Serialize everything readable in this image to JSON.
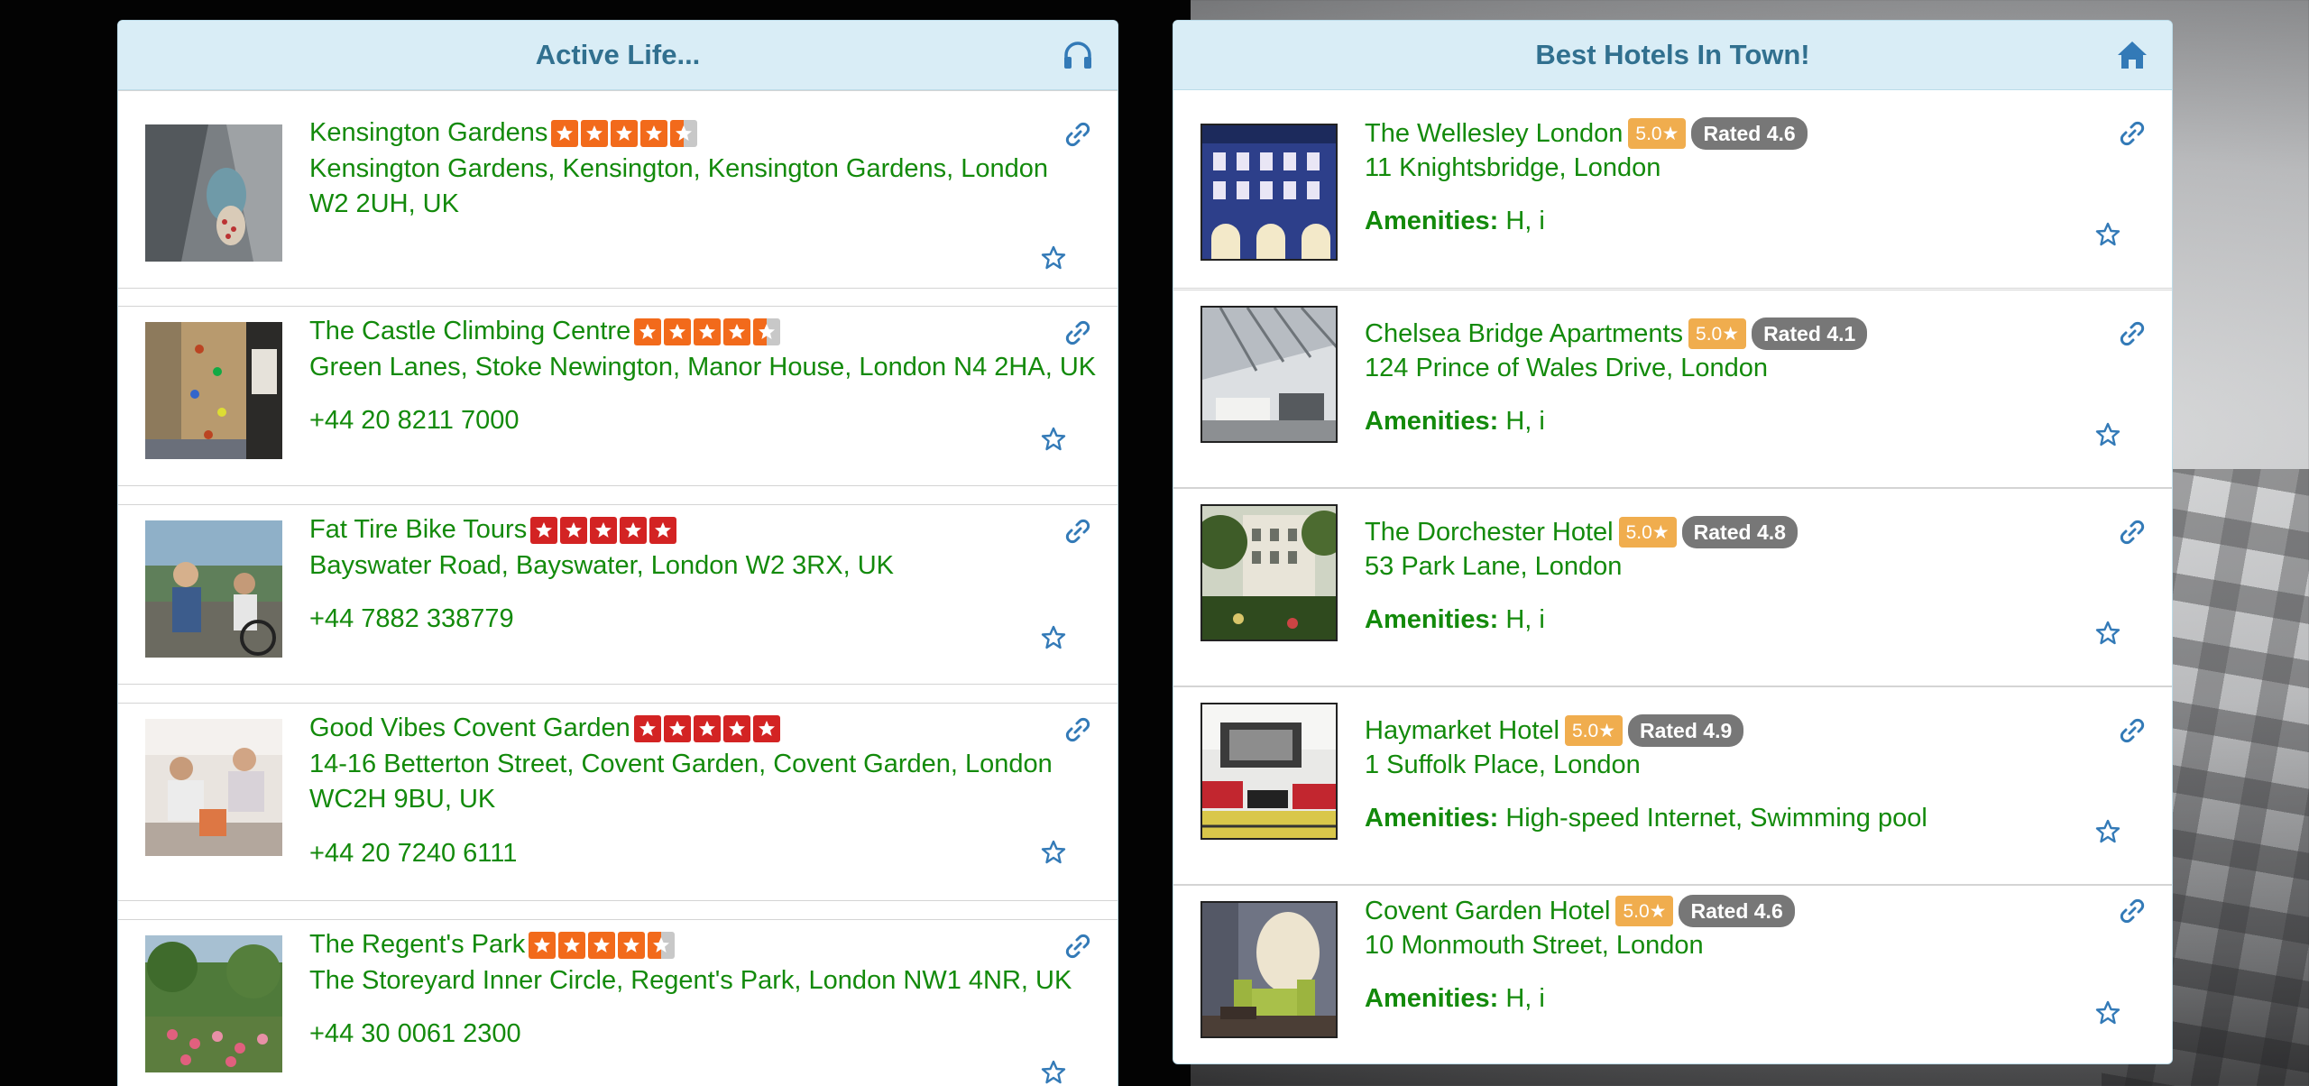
{
  "active": {
    "title": "Active Life...",
    "header_icon": "headphones-icon",
    "items": [
      {
        "name": "Kensington Gardens",
        "rating": 4.5,
        "star_color": "#f26a1b",
        "address1": "Kensington Gardens, Kensington, Kensington Gardens, London",
        "address2": "W2 2UH, UK",
        "phone": ""
      },
      {
        "name": "The Castle Climbing Centre",
        "rating": 4.5,
        "star_color": "#f26a1b",
        "address1": "Green Lanes, Stoke Newington, Manor House, London N4 2HA, UK",
        "address2": "",
        "phone": "+44 20 8211 7000"
      },
      {
        "name": "Fat Tire Bike Tours",
        "rating": 5,
        "star_color": "#d32323",
        "address1": "Bayswater Road, Bayswater, London W2 3RX, UK",
        "address2": "",
        "phone": "+44 7882 338779"
      },
      {
        "name": "Good Vibes Covent Garden",
        "rating": 5,
        "star_color": "#d32323",
        "address1": "14-16 Betterton Street, Covent Garden, Covent Garden, London",
        "address2": "WC2H 9BU, UK",
        "phone": "+44 20 7240 6111"
      },
      {
        "name": "The Regent's Park",
        "rating": 4.5,
        "star_color": "#f26a1b",
        "address1": "The Storeyard Inner Circle, Regent's Park, London NW1 4NR, UK",
        "address2": "",
        "phone": "+44 30 0061 2300"
      }
    ]
  },
  "hotels": {
    "title": "Best Hotels In Town!",
    "header_icon": "home-icon",
    "amenities_label": "Amenities:",
    "items": [
      {
        "name": "The Wellesley London",
        "stars": "5.0★",
        "rated": "Rated 4.6",
        "address": "11 Knightsbridge, London",
        "amenities": "H, i"
      },
      {
        "name": "Chelsea Bridge Apartments",
        "stars": "5.0★",
        "rated": "Rated 4.1",
        "address": "124 Prince of Wales Drive, London",
        "amenities": "H, i"
      },
      {
        "name": "The Dorchester Hotel",
        "stars": "5.0★",
        "rated": "Rated 4.8",
        "address": "53 Park Lane, London",
        "amenities": "H, i"
      },
      {
        "name": "Haymarket Hotel",
        "stars": "5.0★",
        "rated": "Rated 4.9",
        "address": "1 Suffolk Place, London",
        "amenities": "High-speed Internet, Swimming pool"
      },
      {
        "name": "Covent Garden Hotel",
        "stars": "5.0★",
        "rated": "Rated 4.6",
        "address": "10 Monmouth Street, London",
        "amenities": "H, i"
      }
    ]
  },
  "colors": {
    "link_text": "#138a0b",
    "header_text": "#31708f",
    "header_bg": "#d9edf6",
    "icon_blue": "#337ab7",
    "badge_gold": "#f0ad4e",
    "badge_gray": "#777777"
  }
}
